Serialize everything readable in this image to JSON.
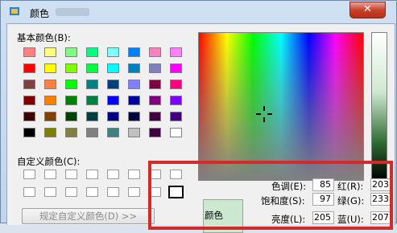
{
  "window": {
    "title": "颜色",
    "close_label": "✕"
  },
  "basic_colors": {
    "label": "基本颜色(B):",
    "swatches": [
      "#ff8080",
      "#ffff80",
      "#80ff80",
      "#00ff80",
      "#80ffff",
      "#0080ff",
      "#ff80c0",
      "#ff80ff",
      "#ff0000",
      "#ffff00",
      "#80ff00",
      "#00ff40",
      "#00ffff",
      "#0080c0",
      "#8080c0",
      "#ff00ff",
      "#804040",
      "#ff8040",
      "#00ff00",
      "#008080",
      "#004080",
      "#8080ff",
      "#800040",
      "#ff0080",
      "#800000",
      "#ff8000",
      "#008000",
      "#008040",
      "#0000ff",
      "#0000a0",
      "#800080",
      "#8000ff",
      "#400000",
      "#804000",
      "#004000",
      "#004040",
      "#000080",
      "#000040",
      "#400040",
      "#400080",
      "#000000",
      "#808000",
      "#808040",
      "#808080",
      "#408080",
      "#c0c0c0",
      "#400040",
      "#ffffff"
    ]
  },
  "custom_colors": {
    "label": "自定义颜色(C):",
    "count": 16
  },
  "define_button": {
    "label": "规定自定义颜色(D) >>"
  },
  "preview": {
    "label": "颜色",
    "color": "#cde8d1"
  },
  "fields": {
    "hue": {
      "label": "色调(E):",
      "value": "85"
    },
    "sat": {
      "label": "饱和度(S):",
      "value": "97"
    },
    "lum": {
      "label": "亮度(L):",
      "value": "205"
    },
    "red": {
      "label": "红(R):",
      "value": "203"
    },
    "green": {
      "label": "绿(G):",
      "value": "233"
    },
    "blue": {
      "label": "蓝(U):",
      "value": "207"
    }
  },
  "colors": {
    "highlight": "#d42a2a"
  }
}
